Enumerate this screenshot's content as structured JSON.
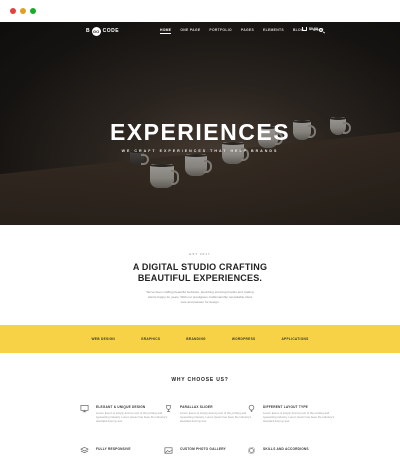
{
  "browser": {
    "dots": [
      "close",
      "minimize",
      "maximize"
    ]
  },
  "nav": {
    "logo_text": "CODE",
    "logo_prefix": "B",
    "logo_mark": "GO",
    "items": [
      "HOME",
      "ONE PAGE",
      "PORTFOLIO",
      "PAGES",
      "ELEMENTS",
      "BLOG",
      "SHOP"
    ],
    "active_index": 0,
    "cart_label": "$0.00",
    "icons": [
      "cart-icon",
      "search-icon"
    ]
  },
  "hero": {
    "title": "EXPERIENCES",
    "subtitle": "WE CRAFT EXPERIENCES THAT HELP BRANDS",
    "slide_count": 3,
    "active_slide": 0
  },
  "intro": {
    "est": "EST 2017",
    "headline_line1": "A DIGITAL STUDIO CRAFTING",
    "headline_line2": "BEAUTIFUL EXPERIENCES.",
    "text": "We've been crafting beautiful websites, launching stunning brands and making clients happy for years. With our prestigious craftsmanship remarkable client care and passion for design."
  },
  "band": {
    "items": [
      "WEB DESIGN",
      "GRAPHICS",
      "BRANDING",
      "WORDPRESS",
      "APPLICATIONS"
    ],
    "color": "#f7d246"
  },
  "why": {
    "title": "WHY CHOOSE US?",
    "features": [
      {
        "icon": "monitor-icon",
        "title": "ELEGANT & UNIQUE DESIGN",
        "text": "Lorem Ipsum is simply dummy text of the printing and typesetting industry. Lorem Ipsum has been the industry's standard dummy text."
      },
      {
        "icon": "trophy-icon",
        "title": "PARALLAX SLIDER",
        "text": "Lorem Ipsum is simply dummy text of the printing and typesetting industry. Lorem Ipsum has been the industry's standard dummy text."
      },
      {
        "icon": "lightbulb-icon",
        "title": "DIFFERENT LAYOUT TYPE",
        "text": "Lorem Ipsum is simply dummy text of the printing and typesetting industry. Lorem Ipsum has been the industry's standard dummy text."
      },
      {
        "icon": "layers-icon",
        "title": "FULLY RESPONSIVE",
        "text": ""
      },
      {
        "icon": "image-icon",
        "title": "CUSTOM PHOTO GALLERY",
        "text": ""
      },
      {
        "icon": "gear-icon",
        "title": "SKILLS AND ACCORDIONS",
        "text": ""
      }
    ]
  }
}
